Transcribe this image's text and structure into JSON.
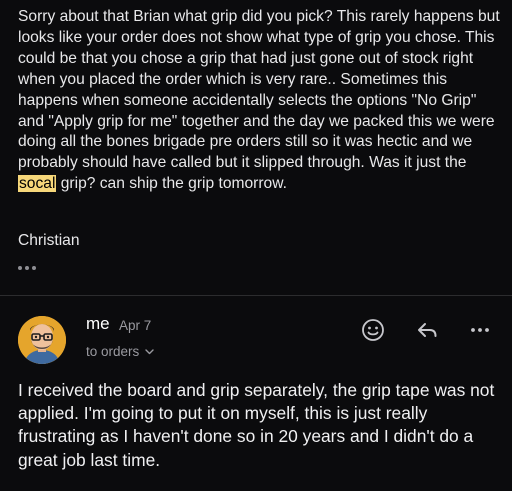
{
  "quoted_message": {
    "before_highlight": "Sorry about that Brian what grip did you pick? This rarely happens but looks like your order does not show what type of grip you chose. This could be that you chose a grip that had just gone out of stock right when you placed the order which is very rare.. Sometimes this happens when someone accidentally selects the options \"No Grip\" and \"Apply grip for me\" together and the day we packed this we were doing all the bones brigade pre orders still so it was hectic and we probably should have called but it slipped through. Was it just the ",
    "highlight": "socal",
    "after_highlight": " grip? can ship the grip tomorrow.",
    "signature": "Christian",
    "highlight_color": "#f6d77a"
  },
  "reply": {
    "sender": "me",
    "date": "Apr 7",
    "recipients": "to orders",
    "body": "I received the board and grip separately, the grip tape was not applied. I'm going to put it on myself, this is just really frustrating as I haven't done so in 20 years and I didn't do a great job last time."
  },
  "icons": {
    "more_quoted": "ellipsis-icon",
    "emoji": "smiley-icon",
    "reply": "reply-arrow-icon",
    "more": "ellipsis-icon",
    "expand": "chevron-down-icon"
  },
  "colors": {
    "background": "#0b0b0d",
    "divider": "#2c2c2e",
    "secondary_text": "#9a9aa0"
  }
}
